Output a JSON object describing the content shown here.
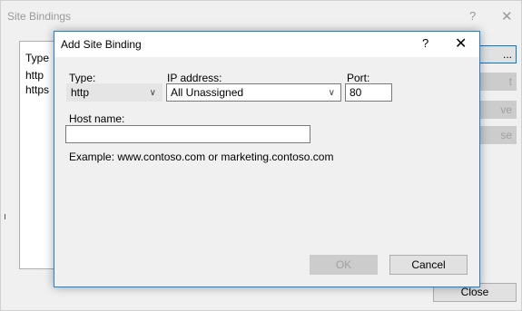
{
  "background_window": {
    "title": "Site Bindings",
    "help_icon": "?",
    "close_icon": "✕",
    "list": {
      "header": "Type",
      "items": [
        "http",
        "https"
      ]
    },
    "buttons": [
      {
        "label": "..."
      },
      {
        "label": "t"
      },
      {
        "label": "ve"
      },
      {
        "label": "se"
      }
    ],
    "close_button": "Close"
  },
  "dialog": {
    "title": "Add Site Binding",
    "help_icon": "?",
    "close_icon": "✕",
    "type": {
      "label": "Type:",
      "value": "http"
    },
    "ip": {
      "label": "IP address:",
      "value": "All Unassigned"
    },
    "port": {
      "label": "Port:",
      "value": "80"
    },
    "host": {
      "label": "Host name:",
      "value": ""
    },
    "example": "Example: www.contoso.com or marketing.contoso.com",
    "ok_label": "OK",
    "cancel_label": "Cancel"
  }
}
